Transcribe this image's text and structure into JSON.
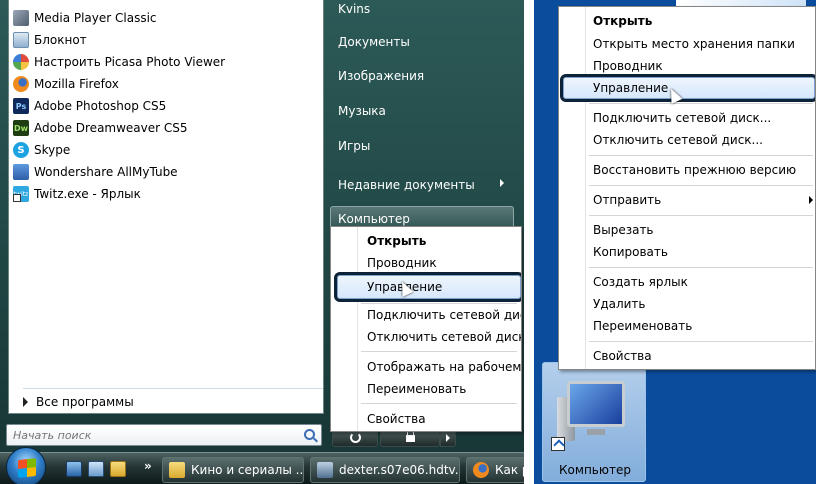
{
  "start_menu": {
    "programs": [
      {
        "label": "Media Player Classic",
        "icon": "media-player-classic-icon"
      },
      {
        "label": "Блокнот",
        "icon": "notepad-icon"
      },
      {
        "label": "Настроить Picasa Photo Viewer",
        "icon": "picasa-icon"
      },
      {
        "label": "Mozilla Firefox",
        "icon": "firefox-icon"
      },
      {
        "label": "Adobe Photoshop CS5",
        "icon": "photoshop-icon"
      },
      {
        "label": "Adobe Dreamweaver CS5",
        "icon": "dreamweaver-icon"
      },
      {
        "label": "Skype",
        "icon": "skype-icon"
      },
      {
        "label": "Wondershare AllMyTube",
        "icon": "allmytube-icon"
      },
      {
        "label": "Twitz.exe - Ярлык",
        "icon": "twitz-icon"
      }
    ],
    "all_programs": "Все программы",
    "search_placeholder": "Начать поиск",
    "right_pane": {
      "user": "Kvins",
      "documents": "Документы",
      "pictures": "Изображения",
      "music": "Музыка",
      "games": "Игры",
      "recent": "Недавние документы",
      "computer": "Компьютер"
    }
  },
  "context_menu_left": {
    "items": [
      "Открыть",
      "Проводник",
      "Управление",
      "Подключить сетевой диск...",
      "Отключить сетевой диск...",
      "Отображать на рабочем сто...",
      "Переименовать",
      "Свойства"
    ],
    "highlighted": "Управление"
  },
  "taskbar": {
    "buttons": [
      "Кино и сериалы ...",
      "dexter.s07e06.hdtv...",
      "Как р"
    ]
  },
  "context_menu_right": {
    "items": [
      "Открыть",
      "Открыть место хранения папки",
      "Проводник",
      "Управление",
      "Подключить сетевой диск...",
      "Отключить сетевой диск...",
      "Восстановить прежнюю версию",
      "Отправить",
      "Вырезать",
      "Копировать",
      "Создать ярлык",
      "Удалить",
      "Переименовать",
      "Свойства"
    ],
    "highlighted": "Управление"
  },
  "desktop": {
    "computer_icon_label": "Компьютер"
  }
}
